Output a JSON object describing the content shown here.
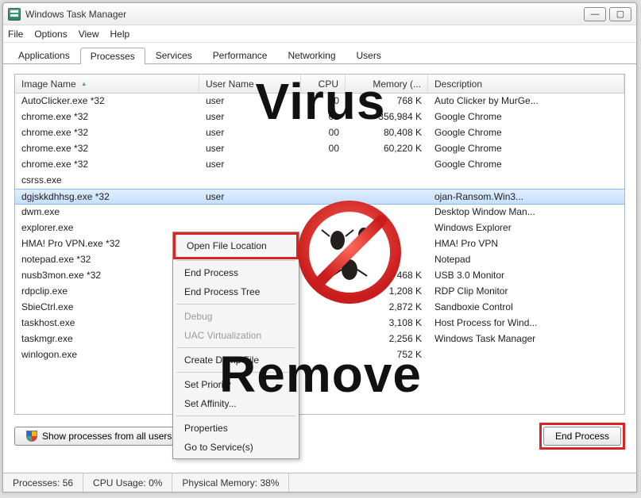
{
  "window": {
    "title": "Windows Task Manager"
  },
  "win_btns": {
    "min": "—",
    "max": "▢",
    "close": ""
  },
  "menu": {
    "file": "File",
    "options": "Options",
    "view": "View",
    "help": "Help"
  },
  "tabs": {
    "applications": "Applications",
    "processes": "Processes",
    "services": "Services",
    "performance": "Performance",
    "networking": "Networking",
    "users": "Users"
  },
  "colheaders": {
    "image": "Image Name",
    "user": "User Name",
    "cpu": "CPU",
    "mem": "Memory (...",
    "desc": "Description"
  },
  "rows": [
    {
      "image": "AutoClicker.exe *32",
      "user": "user",
      "cpu": "00",
      "mem": "768 K",
      "desc": "Auto Clicker by MurGe..."
    },
    {
      "image": "chrome.exe *32",
      "user": "user",
      "cpu": "01",
      "mem": "356,984 K",
      "desc": "Google Chrome"
    },
    {
      "image": "chrome.exe *32",
      "user": "user",
      "cpu": "00",
      "mem": "80,408 K",
      "desc": "Google Chrome"
    },
    {
      "image": "chrome.exe *32",
      "user": "user",
      "cpu": "00",
      "mem": "60,220 K",
      "desc": "Google Chrome"
    },
    {
      "image": "chrome.exe *32",
      "user": "user",
      "cpu": "",
      "mem": "",
      "desc": "Google Chrome"
    },
    {
      "image": "csrss.exe",
      "user": "",
      "cpu": "",
      "mem": "",
      "desc": ""
    },
    {
      "image": "dgjskkdhhsg.exe *32",
      "user": "user",
      "cpu": "",
      "mem": "",
      "desc": "ojan-Ransom.Win3..."
    },
    {
      "image": "dwm.exe",
      "user": "",
      "cpu": "",
      "mem": "",
      "desc": "Desktop Window Man..."
    },
    {
      "image": "explorer.exe",
      "user": "",
      "cpu": "",
      "mem": "",
      "desc": "Windows Explorer"
    },
    {
      "image": "HMA! Pro VPN.exe *32",
      "user": "",
      "cpu": "",
      "mem": "",
      "desc": "HMA! Pro VPN"
    },
    {
      "image": "notepad.exe *32",
      "user": "",
      "cpu": "",
      "mem": "",
      "desc": "Notepad"
    },
    {
      "image": "nusb3mon.exe *32",
      "user": "",
      "cpu": "",
      "mem": "468 K",
      "desc": "USB 3.0 Monitor"
    },
    {
      "image": "rdpclip.exe",
      "user": "",
      "cpu": "",
      "mem": "1,208 K",
      "desc": "RDP Clip Monitor"
    },
    {
      "image": "SbieCtrl.exe",
      "user": "",
      "cpu": "",
      "mem": "2,872 K",
      "desc": "Sandboxie Control"
    },
    {
      "image": "taskhost.exe",
      "user": "",
      "cpu": "",
      "mem": "3,108 K",
      "desc": "Host Process for Wind..."
    },
    {
      "image": "taskmgr.exe",
      "user": "",
      "cpu": "",
      "mem": "2,256 K",
      "desc": "Windows Task Manager"
    },
    {
      "image": "winlogon.exe",
      "user": "",
      "cpu": "",
      "mem": "752 K",
      "desc": ""
    }
  ],
  "selected_index": 6,
  "context_menu": {
    "open_location": "Open File Location",
    "end_process": "End Process",
    "end_tree": "End Process Tree",
    "debug": "Debug",
    "uac": "UAC Virtualization",
    "dump": "Create Dump File",
    "priority": "Set Priority",
    "affinity": "Set Affinity...",
    "properties": "Properties",
    "goto_service": "Go to Service(s)"
  },
  "buttons": {
    "show_all": "Show processes from all users",
    "end_process": "End Process"
  },
  "status": {
    "processes": "Processes: 56",
    "cpu": "CPU Usage: 0%",
    "mem": "Physical Memory: 38%"
  },
  "overlay": {
    "virus": "Virus",
    "remove": "Remove"
  }
}
